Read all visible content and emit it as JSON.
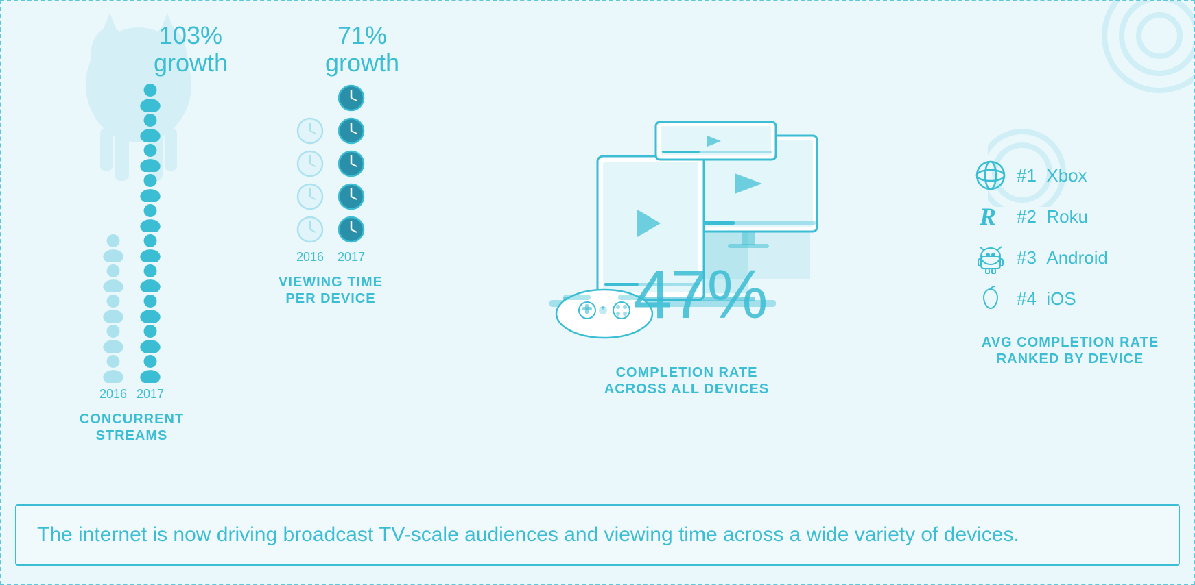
{
  "concurrent": {
    "growth_pct": "103%",
    "growth_label": "growth",
    "year_2016": "2016",
    "year_2017": "2017",
    "title_line1": "CONCURRENT",
    "title_line2": "STREAMS",
    "figures_2016": 5,
    "figures_2017": 10
  },
  "viewing": {
    "growth_pct": "71%",
    "growth_label": "growth",
    "year_2016": "2016",
    "year_2017": "2017",
    "title_line1": "VIEWING TIME",
    "title_line2": "PER DEVICE",
    "clocks_2016": 4,
    "clocks_2017": 5
  },
  "completion": {
    "rate": "47%",
    "title_line1": "COMPLETION RATE",
    "title_line2": "ACROSS ALL DEVICES"
  },
  "ranking": {
    "title_line1": "AVG COMPLETION RATE",
    "title_line2": "RANKED BY DEVICE",
    "items": [
      {
        "rank": "#1",
        "name": "Xbox"
      },
      {
        "rank": "#2",
        "name": "Roku"
      },
      {
        "rank": "#3",
        "name": "Android"
      },
      {
        "rank": "#4",
        "name": "iOS"
      }
    ]
  },
  "quote": {
    "text": "The internet is now driving broadcast TV-scale audiences and viewing time across a wide variety of devices."
  },
  "colors": {
    "accent": "#3bbdd4",
    "light": "#a8dce8",
    "dim": "#c5e8f0"
  }
}
